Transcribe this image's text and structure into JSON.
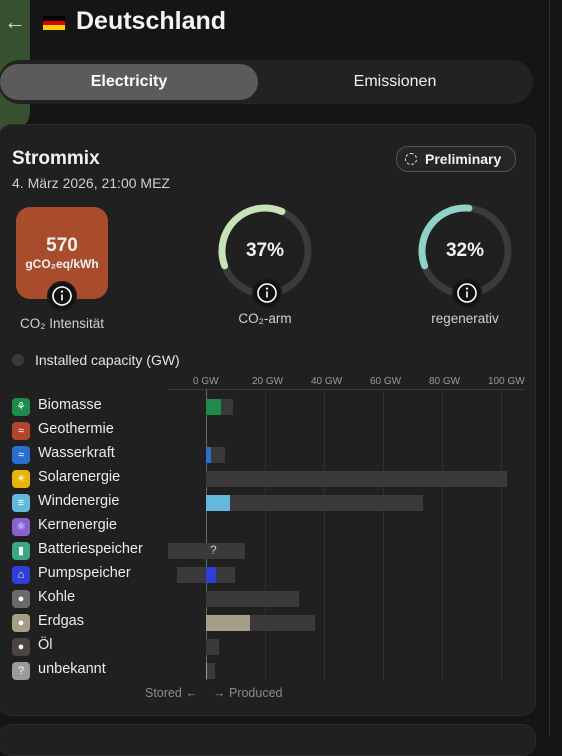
{
  "header": {
    "back_icon": "arrow-left-icon",
    "country": "Deutschland",
    "flag_colors": [
      "#000000",
      "#dd0000",
      "#ffce00"
    ]
  },
  "tabs": [
    {
      "label": "Electricity",
      "active": true
    },
    {
      "label": "Emissionen",
      "active": false
    }
  ],
  "card": {
    "title": "Strommix",
    "date": "4. März 2026, 21:00 MEZ",
    "badge": "Preliminary",
    "co2": {
      "value": "570",
      "unit": "gCO₂eq/kWh",
      "label": "CO₂ Intensität",
      "color": "#a84c2c"
    },
    "low_carbon": {
      "value": "37%",
      "fraction": 0.37,
      "label": "CO₂-arm",
      "color": "#c5e3b5"
    },
    "renewable": {
      "value": "32%",
      "fraction": 0.32,
      "label": "regenerativ",
      "color": "#8fd3c8"
    },
    "capacity_toggle_label": "Installed capacity (GW)"
  },
  "chart": {
    "ticks": [
      "0 GW",
      "20 GW",
      "40 GW",
      "60 GW",
      "80 GW",
      "100 GW"
    ],
    "stored_label": "Stored ←",
    "produced_label": "→ Produced"
  },
  "chart_data": {
    "type": "bar",
    "unit": "GW",
    "xlim": [
      -13,
      110
    ],
    "categories": [
      "Biomasse",
      "Geothermie",
      "Wasserkraft",
      "Solarenergie",
      "Windenergie",
      "Kernenergie",
      "Batteriespeicher",
      "Pumpspeicher",
      "Kohle",
      "Erdgas",
      "Öl",
      "unbekannt"
    ],
    "series": [
      {
        "name": "Produced",
        "values": [
          5.2,
          0,
          1.6,
          0,
          8.1,
          0,
          0,
          3.3,
          0,
          14.8,
          0,
          0.5
        ]
      },
      {
        "name": "Installed capacity",
        "values": [
          9.3,
          0,
          6.3,
          102,
          73.5,
          0,
          13.2,
          9.8,
          31.5,
          37.1,
          4.5,
          3.2
        ]
      },
      {
        "name": "Storage capacity",
        "values": [
          0,
          0,
          0,
          0,
          0,
          0,
          -13,
          -10,
          0,
          0,
          0,
          0
        ]
      }
    ],
    "unknown_markers": [
      "?"
    ]
  },
  "sources": [
    {
      "name": "Biomasse",
      "icon": "seedling-icon",
      "color": "#1e8a4c",
      "prod_color": "#1e8a4c"
    },
    {
      "name": "Geothermie",
      "icon": "heat-waves-icon",
      "color": "#b3462a",
      "prod_color": "#b3462a"
    },
    {
      "name": "Wasserkraft",
      "icon": "water-waves-icon",
      "color": "#2a6fd0",
      "prod_color": "#2a6fd0"
    },
    {
      "name": "Solarenergie",
      "icon": "sun-icon",
      "color": "#e8b400",
      "prod_color": "#e8b400"
    },
    {
      "name": "Windenergie",
      "icon": "wind-icon",
      "color": "#63b9dc",
      "prod_color": "#63b9dc"
    },
    {
      "name": "Kernenergie",
      "icon": "atom-icon",
      "color": "#8a5fd1",
      "prod_color": "#8a5fd1"
    },
    {
      "name": "Batteriespeicher",
      "icon": "battery-icon",
      "color": "#3aa883",
      "prod_color": "#3aa883"
    },
    {
      "name": "Pumpspeicher",
      "icon": "pump-icon",
      "color": "#2f3ed8",
      "prod_color": "#2f3ed8"
    },
    {
      "name": "Kohle",
      "icon": "coal-drop-icon",
      "color": "#6a6a6a",
      "prod_color": "#6a6a6a"
    },
    {
      "name": "Erdgas",
      "icon": "gas-flame-icon",
      "color": "#a59e87",
      "prod_color": "#a59e87"
    },
    {
      "name": "Öl",
      "icon": "oil-drop-icon",
      "color": "#4b4440",
      "prod_color": "#4b4440"
    },
    {
      "name": "unbekannt",
      "icon": "question-icon",
      "color": "#9a9a9a",
      "prod_color": "#9a9a9a"
    }
  ]
}
